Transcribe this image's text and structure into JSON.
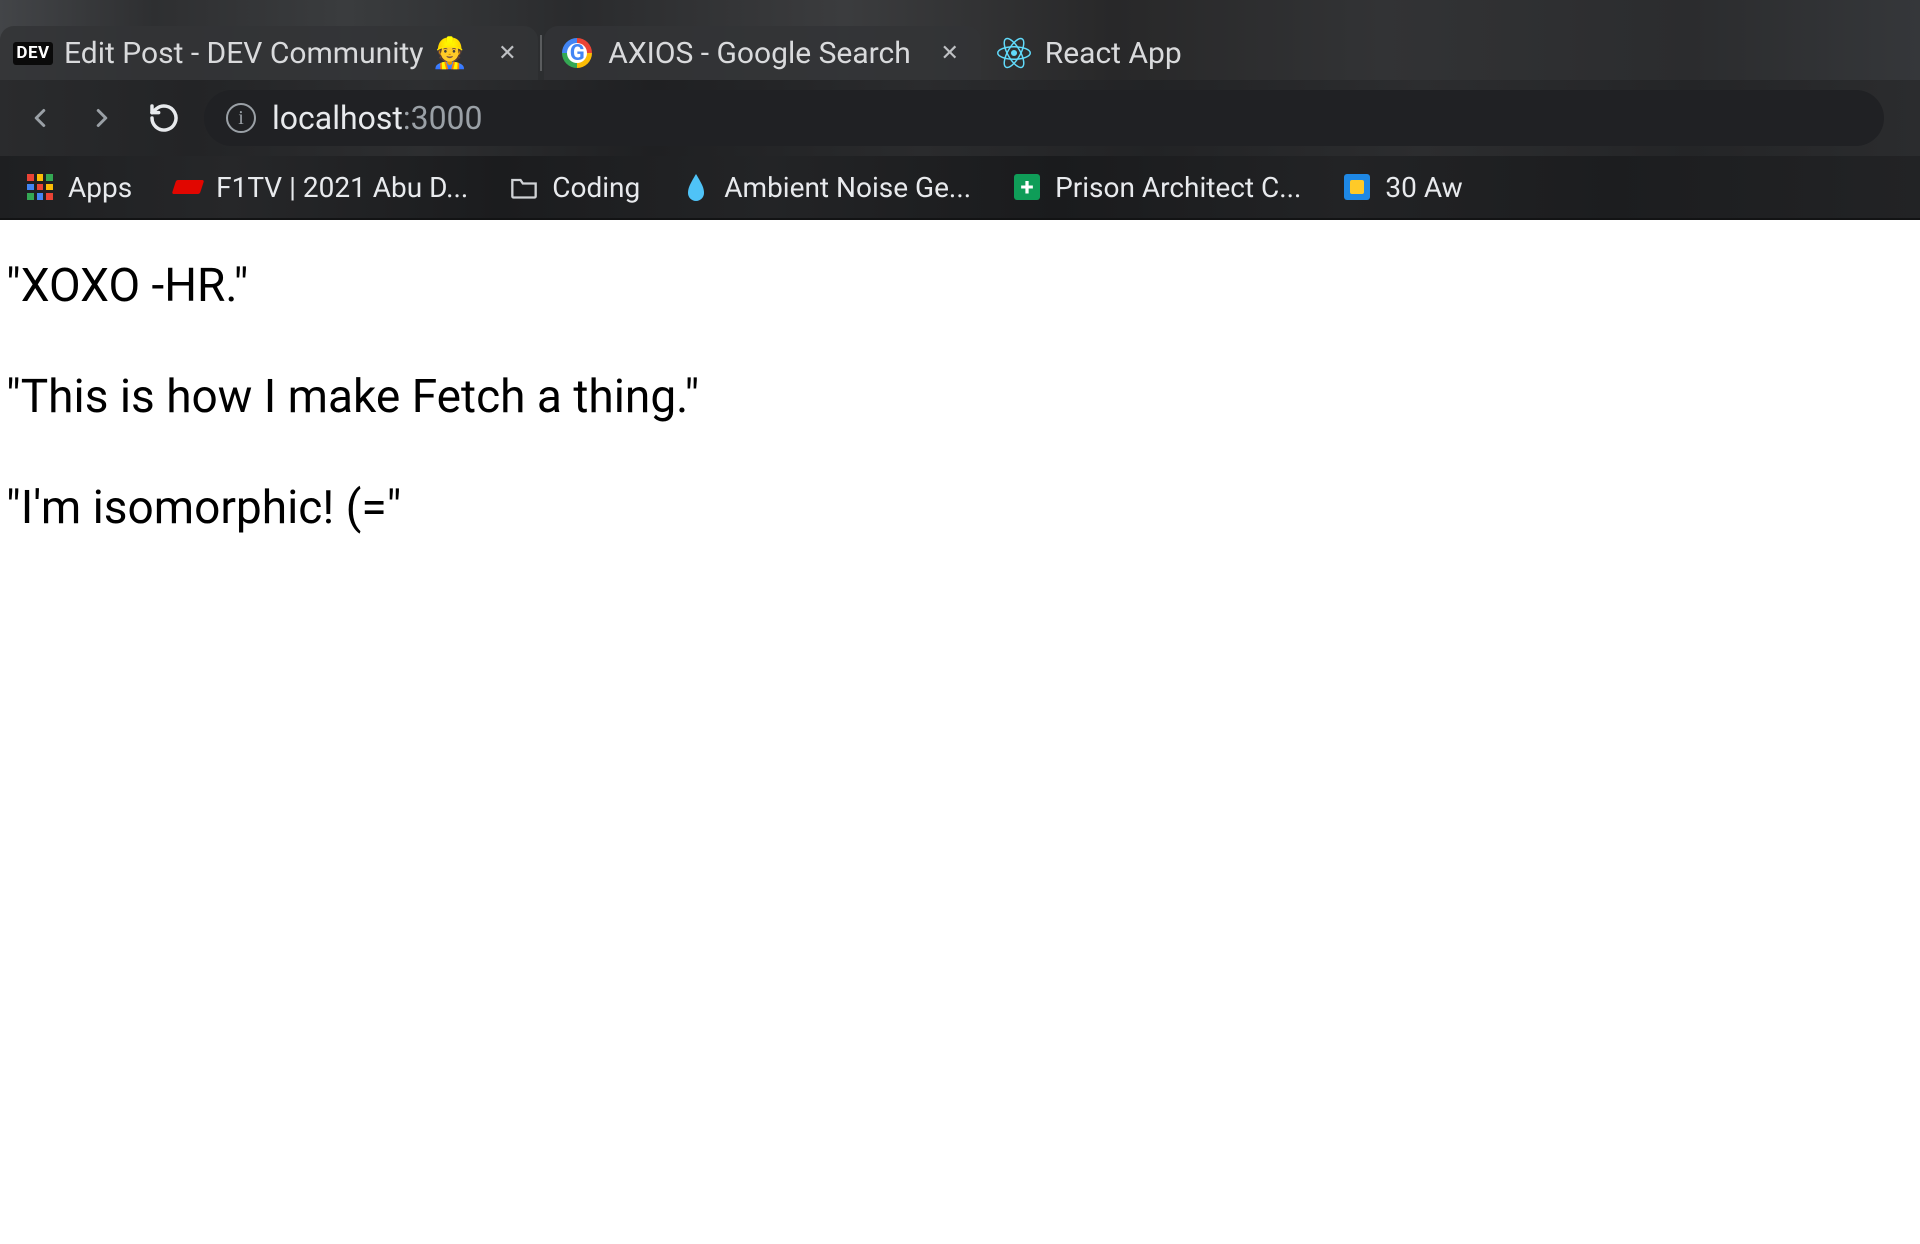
{
  "tabs": [
    {
      "label": "Edit Post - DEV Community 👷",
      "favicon": "dev",
      "active": false,
      "closable": true
    },
    {
      "label": "AXIOS - Google Search",
      "favicon": "google",
      "active": false,
      "closable": true
    },
    {
      "label": "React App",
      "favicon": "react",
      "active": true,
      "closable": false
    }
  ],
  "toolbar": {
    "back_enabled": false,
    "forward_enabled": false,
    "reload_enabled": true,
    "url_host": "localhost",
    "url_port": ":3000"
  },
  "bookmarks": [
    {
      "icon": "apps",
      "label": "Apps"
    },
    {
      "icon": "f1",
      "label": "F1TV | 2021 Abu D..."
    },
    {
      "icon": "folder",
      "label": "Coding"
    },
    {
      "icon": "drop",
      "label": "Ambient Noise Ge..."
    },
    {
      "icon": "plus",
      "label": "Prison Architect C..."
    },
    {
      "icon": "square",
      "label": "30 Aw"
    }
  ],
  "page": {
    "lines": [
      "\"XOXO -HR.\"",
      "\"This is how I make Fetch a thing.\"",
      "\"I'm isomorphic! (=\""
    ]
  },
  "icons": {
    "close_glyph": "✕",
    "dev_text": "DEV",
    "google_g": "G"
  }
}
